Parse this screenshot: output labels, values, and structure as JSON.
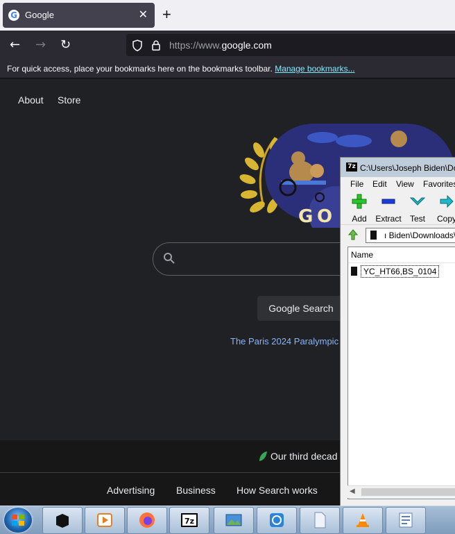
{
  "browser": {
    "tab": {
      "title": "Google",
      "favicon": "google-g-icon",
      "close_icon": "close-icon"
    },
    "new_tab_icon": "plus-icon",
    "nav": {
      "back_icon": "back-arrow-icon",
      "forward_icon": "forward-arrow-icon",
      "reload_icon": "reload-icon"
    },
    "url": {
      "prefix": "https://www.",
      "domain": "google.com"
    },
    "bookmarks": {
      "message": "For quick access, place your bookmarks here on the bookmarks toolbar.",
      "link": "Manage bookmarks..."
    }
  },
  "google": {
    "top_links": [
      "About",
      "Store"
    ],
    "search_button": "Google Search",
    "promo": "The Paris 2024 Paralympic",
    "footer_message": "Our third decad",
    "footer_links": [
      "Advertising",
      "Business",
      "How Search works"
    ]
  },
  "zip_window": {
    "title": "C:\\Users\\Joseph Biden\\Do",
    "app_icon": "7z",
    "menu": [
      "File",
      "Edit",
      "View",
      "Favorites"
    ],
    "toolbar": [
      {
        "label": "Add",
        "icon": "green-plus-icon"
      },
      {
        "label": "Extract",
        "icon": "blue-minus-icon"
      },
      {
        "label": "Test",
        "icon": "teal-check-icon"
      },
      {
        "label": "Copy",
        "icon": "copy-arrow-icon"
      }
    ],
    "path": "ı Biden\\Downloads\\",
    "column_name": "Name",
    "files": [
      "YC_HT66,BS_0104"
    ]
  },
  "taskbar": {
    "items": [
      "windows-start-icon",
      "terminal-icon",
      "media-player-icon",
      "firefox-icon",
      "7zip-icon",
      "photo-viewer-icon",
      "app-icon",
      "file-icon",
      "vlc-icon",
      "document-icon"
    ],
    "zip_label": "7z"
  },
  "colors": {
    "page_bg": "#202124",
    "chrome_bg": "#2b2a33",
    "link": "#8ab4f8"
  }
}
